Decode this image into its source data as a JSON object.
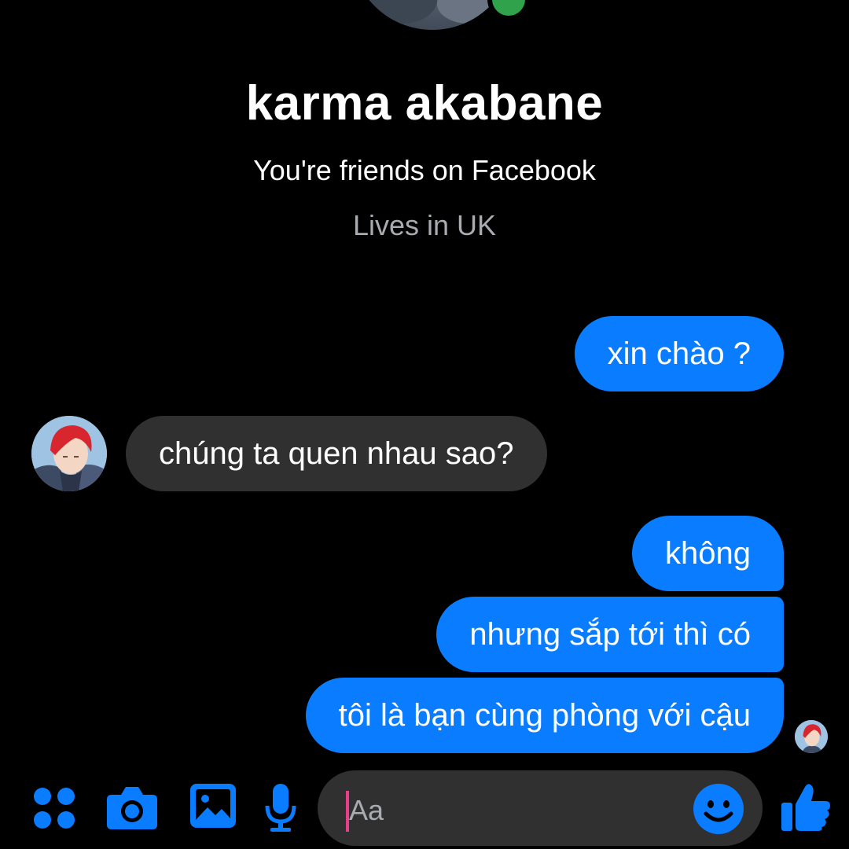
{
  "profile": {
    "name": "karma akabane",
    "relationship": "You're friends on Facebook",
    "location": "Lives in UK"
  },
  "messages": [
    {
      "direction": "outgoing",
      "text": "xin chào ?"
    },
    {
      "direction": "incoming",
      "text": "chúng ta quen nhau sao?"
    },
    {
      "direction": "outgoing",
      "text": "không"
    },
    {
      "direction": "outgoing",
      "text": "nhưng sắp tới thì có"
    },
    {
      "direction": "outgoing",
      "text": "tôi là bạn cùng phòng với cậu"
    }
  ],
  "composer": {
    "placeholder": "Aa",
    "icons": [
      "menu-icon",
      "camera-icon",
      "gallery-icon",
      "microphone-icon",
      "emoji-icon",
      "thumbs-up-icon"
    ]
  },
  "colors": {
    "accent": "#0a7cff",
    "incoming_bubble": "#303030",
    "background": "#000000",
    "online": "#31a24c",
    "secondary_text": "#a8abaf",
    "caret": "#e83e8c"
  }
}
